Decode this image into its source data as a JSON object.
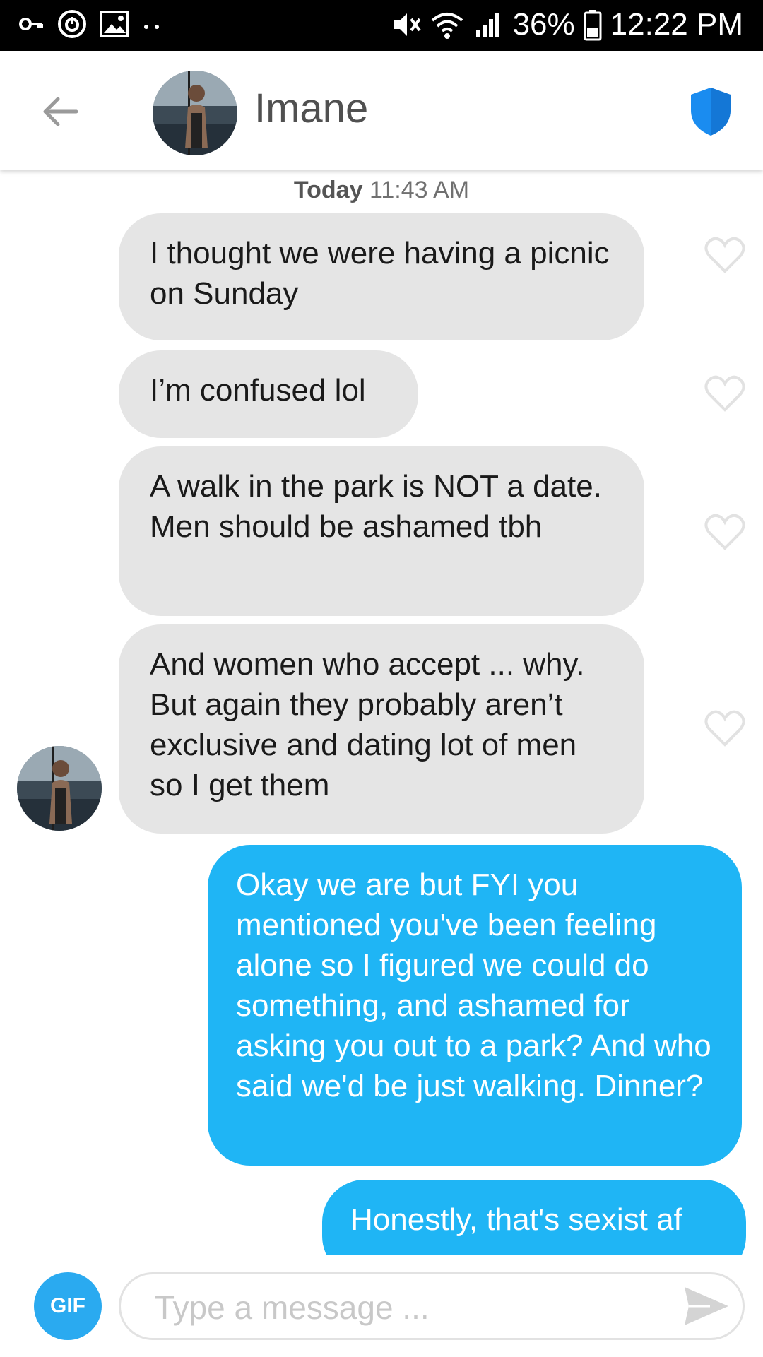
{
  "status_bar": {
    "battery": "36%",
    "time": "12:22 PM",
    "icons": [
      "key-icon",
      "power-icon",
      "image-icon",
      "dots-icon",
      "mute-icon",
      "wifi-icon",
      "signal-icon",
      "battery-icon"
    ]
  },
  "header": {
    "name": "Imane",
    "back_icon": "arrow-left-icon",
    "shield_icon": "shield-icon",
    "accent": "#1a8cf0"
  },
  "chat": {
    "date_day": "Today",
    "date_time": "11:43 AM",
    "messages": [
      {
        "from": "them",
        "text": "I thought we were having a picnic on Sunday"
      },
      {
        "from": "them",
        "text": "I’m confused lol"
      },
      {
        "from": "them",
        "text": "A walk in the park is NOT a date. Men should be ashamed tbh"
      },
      {
        "from": "them",
        "text": "And women who accept ... why. But again they probably aren’t exclusive and dating lot of men so I get them"
      },
      {
        "from": "me",
        "text": "Okay we are but FYI you mentioned you've been feeling alone so I figured we could do something, and ashamed for asking you out to a park? And who said we'd be just walking. Dinner?"
      },
      {
        "from": "me",
        "text": "Honestly, that's sexist af"
      }
    ],
    "incoming_color": "#e5e5e5",
    "outgoing_color": "#1fb5f5"
  },
  "input": {
    "gif_label": "GIF",
    "placeholder": "Type a message ...",
    "send_icon": "send-icon"
  }
}
